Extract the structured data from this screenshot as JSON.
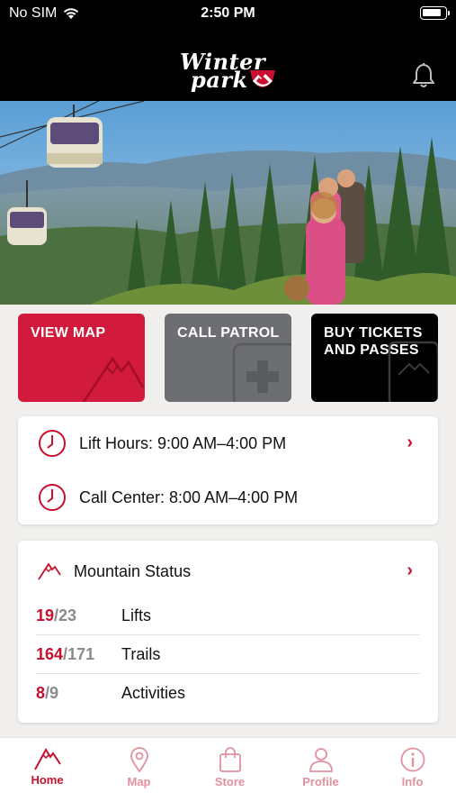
{
  "status_bar": {
    "carrier": "No SIM",
    "time": "2:50 PM"
  },
  "header": {
    "logo_line1": "Winter",
    "logo_line2": "park"
  },
  "tiles": [
    {
      "label": "VIEW MAP"
    },
    {
      "label": "CALL PATROL"
    },
    {
      "label_line1": "BUY TICKETS",
      "label_line2": "AND PASSES"
    }
  ],
  "hours": [
    {
      "text": "Lift Hours: 9:00 AM–4:00 PM"
    },
    {
      "text": "Call Center: 8:00 AM–4:00 PM"
    }
  ],
  "mountain_status": {
    "title": "Mountain Status",
    "rows": [
      {
        "open": "19",
        "total": "23",
        "name": "Lifts"
      },
      {
        "open": "164",
        "total": "171",
        "name": "Trails"
      },
      {
        "open": "8",
        "total": "9",
        "name": "Activities"
      }
    ]
  },
  "tabs": [
    {
      "label": "Home",
      "icon": "mountain-icon",
      "active": true
    },
    {
      "label": "Map",
      "icon": "map-pin-icon",
      "active": false
    },
    {
      "label": "Store",
      "icon": "shopping-bag-icon",
      "active": false
    },
    {
      "label": "Profile",
      "icon": "person-icon",
      "active": false
    },
    {
      "label": "Info",
      "icon": "info-icon",
      "active": false
    }
  ],
  "colors": {
    "accent": "#c8102e",
    "map_tile": "#d21a3c",
    "patrol_tile": "#6d6e71",
    "tickets_tile": "#000000",
    "header": "#000000"
  }
}
